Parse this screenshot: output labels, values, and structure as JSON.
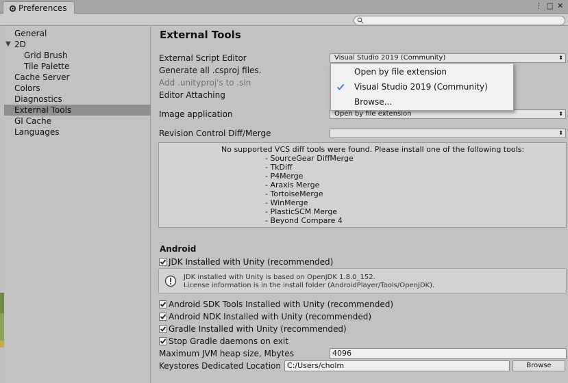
{
  "window": {
    "tab_title": "Preferences",
    "menu_glyph": "⋮",
    "maximize_glyph": "□",
    "close_glyph": "✕"
  },
  "search": {
    "placeholder": ""
  },
  "sidebar": {
    "items": [
      {
        "label": "General"
      },
      {
        "label": "2D"
      },
      {
        "label": "Grid Brush"
      },
      {
        "label": "Tile Palette"
      },
      {
        "label": "Cache Server"
      },
      {
        "label": "Colors"
      },
      {
        "label": "Diagnostics"
      },
      {
        "label": "External Tools"
      },
      {
        "label": "GI Cache"
      },
      {
        "label": "Languages"
      }
    ],
    "selected": "External Tools"
  },
  "main": {
    "title": "External Tools",
    "script_editor_label": "External Script Editor",
    "script_editor_value": "Visual Studio 2019 (Community)",
    "csproj_label": "Generate all .csproj files.",
    "unityproj_label": "Add .unityproj's to .sln",
    "editor_attaching_label": "Editor Attaching",
    "image_app_label": "Image application",
    "image_app_value": "Open by file extension",
    "revision_label": "Revision Control Diff/Merge",
    "revision_value": "",
    "vcs_message": "No supported VCS diff tools were found. Please install one of the following tools:",
    "vcs_tools": [
      "- SourceGear DiffMerge",
      "- TkDiff",
      "- P4Merge",
      "- Araxis Merge",
      "- TortoiseMerge",
      "- WinMerge",
      "- PlasticSCM Merge",
      "- Beyond Compare 4"
    ]
  },
  "android": {
    "heading": "Android",
    "jdk_label": "JDK Installed with Unity (recommended)",
    "jdk_checked": true,
    "jdk_info_line1": "JDK installed with Unity is based on OpenJDK 1.8.0_152.",
    "jdk_info_line2": "License information is in the install folder (AndroidPlayer/Tools/OpenJDK).",
    "sdk_label": "Android SDK Tools Installed with Unity (recommended)",
    "sdk_checked": true,
    "ndk_label": "Android NDK Installed with Unity (recommended)",
    "ndk_checked": true,
    "gradle_label": "Gradle Installed with Unity (recommended)",
    "gradle_checked": true,
    "stop_gradle_label": "Stop Gradle daemons on exit",
    "stop_gradle_checked": true,
    "jvm_heap_label": "Maximum JVM heap size, Mbytes",
    "jvm_heap_value": "4096",
    "keystores_label": "Keystores Dedicated Location",
    "keystores_value": "C:/Users/cholm",
    "browse_label": "Browse"
  },
  "popup_menu": {
    "items": [
      {
        "label": "Open by file extension",
        "checked": false
      },
      {
        "label": "Visual Studio 2019 (Community)",
        "checked": true
      },
      {
        "label": "Browse...",
        "checked": false
      }
    ]
  },
  "colors": {
    "check_blue": "#2a7ad1",
    "selection_gray": "#8f8f8f",
    "panel_gray": "#c2c2c2"
  }
}
